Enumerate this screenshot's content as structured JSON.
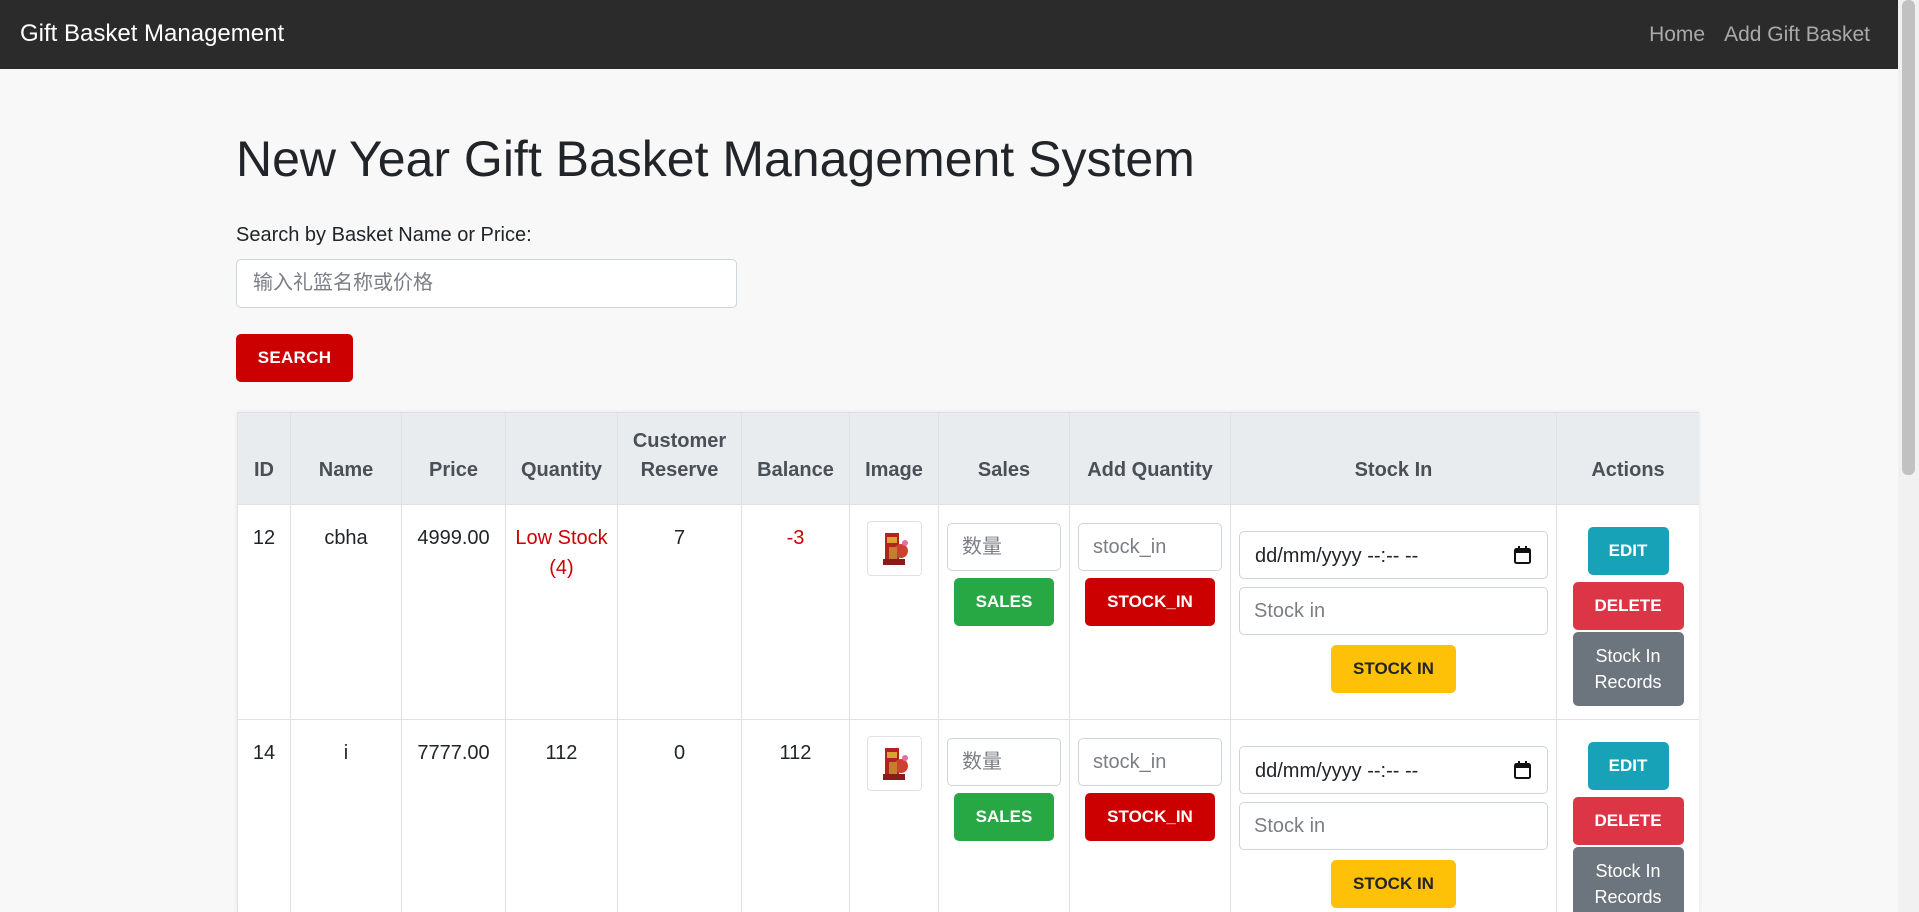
{
  "navbar": {
    "brand": "Gift Basket Management",
    "links": [
      "Home",
      "Add Gift Basket"
    ]
  },
  "page": {
    "title": "New Year Gift Basket Management System",
    "search_label": "Search by Basket Name or Price:",
    "search_placeholder": "输入礼篮名称或价格",
    "search_button": "SEARCH"
  },
  "table": {
    "headers": [
      "ID",
      "Name",
      "Price",
      "Quantity",
      "Customer Reserve",
      "Balance",
      "Image",
      "Sales",
      "Add Quantity",
      "Stock In",
      "Actions"
    ],
    "rows": [
      {
        "id": "12",
        "name": "cbha",
        "price": "4999.00",
        "quantity": "Low Stock (4)",
        "reserve": "7",
        "balance": "-3",
        "sales_placeholder": "数量",
        "sales_button": "SALES",
        "add_qty_placeholder": "stock_in",
        "add_qty_button": "STOCK_IN",
        "date_placeholder": "dd/mm/yyyy --:-- --",
        "stock_in_placeholder": "Stock in",
        "stock_in_button": "STOCK IN",
        "edit": "EDIT",
        "delete": "DELETE",
        "records": "Stock In Records"
      },
      {
        "id": "14",
        "name": "i",
        "price": "7777.00",
        "quantity": "112",
        "reserve": "0",
        "balance": "112",
        "sales_placeholder": "数量",
        "sales_button": "SALES",
        "add_qty_placeholder": "stock_in",
        "add_qty_button": "STOCK_IN",
        "date_placeholder": "dd/mm/yyyy --:-- --",
        "stock_in_placeholder": "Stock in",
        "stock_in_button": "STOCK IN",
        "edit": "EDIT",
        "delete": "DELETE",
        "records": "Stock In Records"
      }
    ]
  },
  "colors": {
    "navbar": "#2b2b2b",
    "primary_red": "#cc0000",
    "sales_green": "#28a745",
    "stock_in_yellow": "#ffc107",
    "edit_teal": "#17a2b8",
    "delete_red": "#dc3545",
    "records_gray": "#6c757d"
  }
}
